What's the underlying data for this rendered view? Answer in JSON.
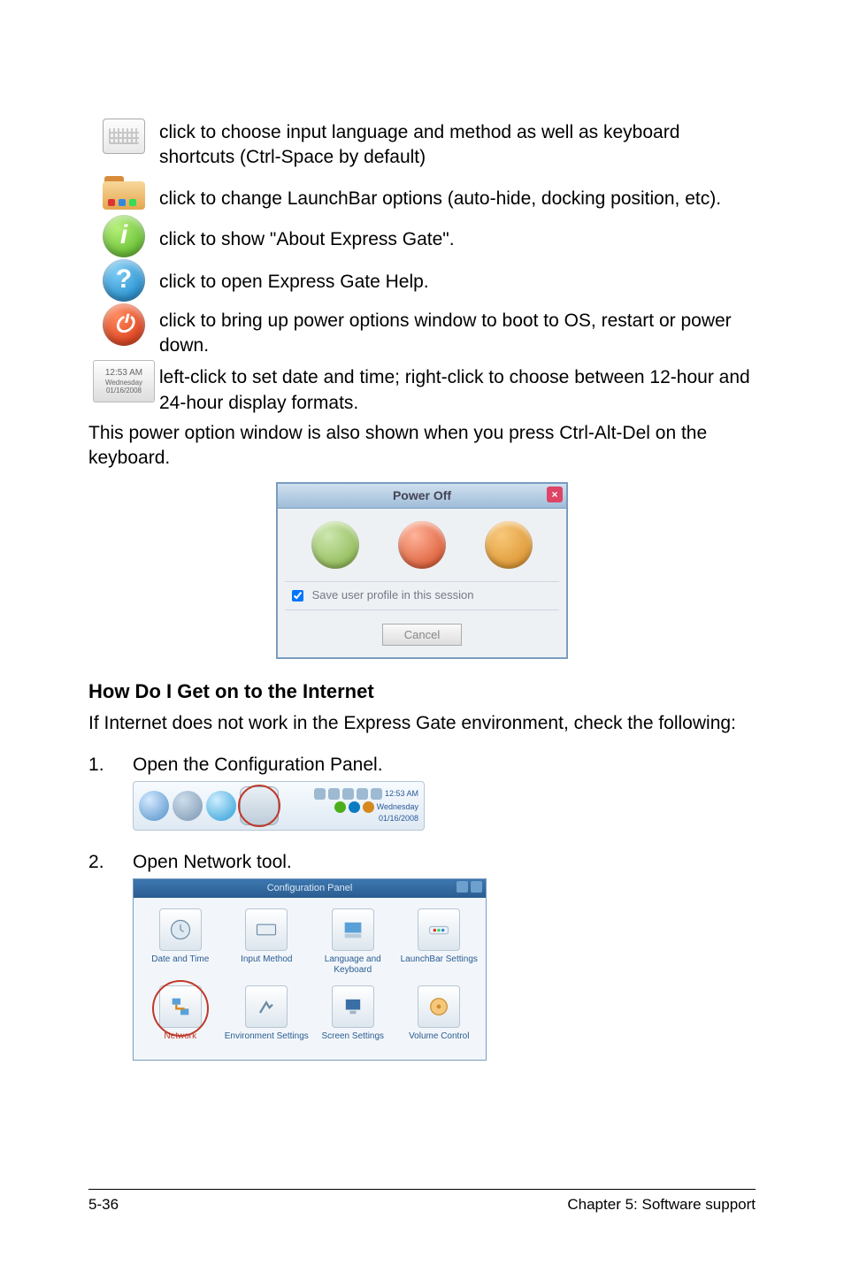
{
  "rows": [
    {
      "icon": "keyboard-icon",
      "text": "click to choose input language and method as well as keyboard shortcuts (Ctrl-Space by default)"
    },
    {
      "icon": "folder-icon",
      "text": "click to change LaunchBar options (auto-hide, docking position, etc)."
    },
    {
      "icon": "info-icon",
      "text": "click to show \"About Express Gate\"."
    },
    {
      "icon": "help-icon",
      "text": "click to open Express Gate Help."
    },
    {
      "icon": "power-icon",
      "text": "click to bring up power options window to boot to OS, restart or power down."
    },
    {
      "icon": "clock-badge",
      "text": "left-click to set date and time; right-click to choose between 12-hour and 24-hour display formats."
    }
  ],
  "clock_badge": {
    "time": "12:53 AM",
    "day": "Wednesday",
    "date": "01/16/2008"
  },
  "after_rows_para": "This power option window is also shown when you press Ctrl-Alt-Del on the keyboard.",
  "power_dialog": {
    "title": "Power Off",
    "checkbox_label": "Save user profile in this session",
    "cancel_label": "Cancel"
  },
  "section_title": "How Do I Get on to the Internet",
  "section_intro": "If Internet does not work in the Express Gate environment, check the following:",
  "steps": [
    "Open the Configuration Panel.",
    "Open Network tool."
  ],
  "launchbar_clock": {
    "time": "12:53 AM",
    "day": "Wednesday",
    "date": "01/16/2008"
  },
  "config_panel": {
    "title": "Configuration Panel",
    "items": [
      "Date and Time",
      "Input Method",
      "Language and Keyboard",
      "LaunchBar Settings",
      "Network",
      "Environment Settings",
      "Screen Settings",
      "Volume Control"
    ]
  },
  "footer": {
    "left": "5-36",
    "right": "Chapter 5: Software support"
  }
}
